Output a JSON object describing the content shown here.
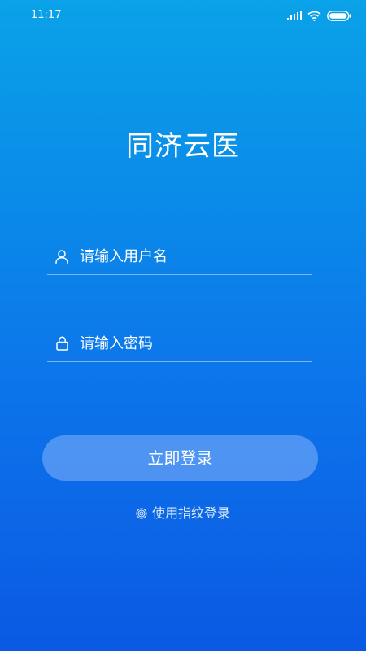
{
  "status_bar": {
    "time": "11:17",
    "icons": [
      "signal-icon",
      "wifi-icon",
      "battery-icon"
    ]
  },
  "app": {
    "title": "同济云医"
  },
  "form": {
    "username_placeholder": "请输入用户名",
    "username_value": "",
    "password_placeholder": "请输入密码",
    "password_value": "",
    "login_label": "立即登录",
    "fingerprint_label": "使用指纹登录"
  },
  "icons": {
    "username": "user-icon",
    "password": "lock-icon",
    "fingerprint": "fingerprint-icon"
  },
  "colors": {
    "background_top": "#0aa2e8",
    "background_bottom": "#0b59e3",
    "text": "#ffffff",
    "button_fill": "#a0c3ff"
  }
}
